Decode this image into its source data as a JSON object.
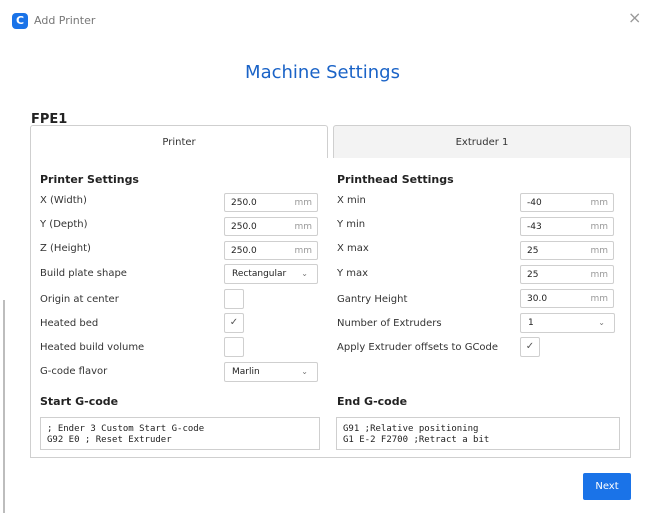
{
  "window": {
    "title": "Add Printer",
    "icon": "cura-logo-icon",
    "close_glyph": "×"
  },
  "heading": "Machine Settings",
  "printer_name": "FPE1",
  "tabs": [
    {
      "label": "Printer",
      "active": true
    },
    {
      "label": "Extruder 1",
      "active": false
    }
  ],
  "printer_settings": {
    "title": "Printer Settings",
    "x_width": {
      "label": "X (Width)",
      "value": "250.0",
      "unit": "mm"
    },
    "y_depth": {
      "label": "Y (Depth)",
      "value": "250.0",
      "unit": "mm"
    },
    "z_height": {
      "label": "Z (Height)",
      "value": "250.0",
      "unit": "mm"
    },
    "build_plate_shape": {
      "label": "Build plate shape",
      "value": "Rectangular"
    },
    "origin_at_center": {
      "label": "Origin at center",
      "checked": false,
      "mark": ""
    },
    "heated_bed": {
      "label": "Heated bed",
      "checked": true,
      "mark": "✓"
    },
    "heated_build_volume": {
      "label": "Heated build volume",
      "checked": false,
      "mark": ""
    },
    "gcode_flavor": {
      "label": "G-code flavor",
      "value": "Marlin"
    }
  },
  "printhead_settings": {
    "title": "Printhead Settings",
    "x_min": {
      "label": "X min",
      "value": "-40",
      "unit": "mm"
    },
    "y_min": {
      "label": "Y min",
      "value": "-43",
      "unit": "mm"
    },
    "x_max": {
      "label": "X max",
      "value": "25",
      "unit": "mm"
    },
    "y_max": {
      "label": "Y max",
      "value": "25",
      "unit": "mm"
    },
    "gantry_height": {
      "label": "Gantry Height",
      "value": "30.0",
      "unit": "mm"
    },
    "number_of_extruders": {
      "label": "Number of Extruders",
      "value": "1"
    },
    "apply_offsets": {
      "label": "Apply Extruder offsets to GCode",
      "checked": true,
      "mark": "✓"
    }
  },
  "start_gcode": {
    "title": "Start G-code",
    "lines": [
      "; Ender 3 Custom Start G-code",
      "G92 E0 ; Reset Extruder"
    ]
  },
  "end_gcode": {
    "title": "End G-code",
    "lines": [
      "G91 ;Relative positioning",
      "G1 E-2 F2700 ;Retract a bit"
    ]
  },
  "chevron_glyph": "⌄",
  "next_label": "Next",
  "colors": {
    "accent": "#1a73e8",
    "heading": "#1a63c7",
    "border": "#cfcfcf"
  }
}
